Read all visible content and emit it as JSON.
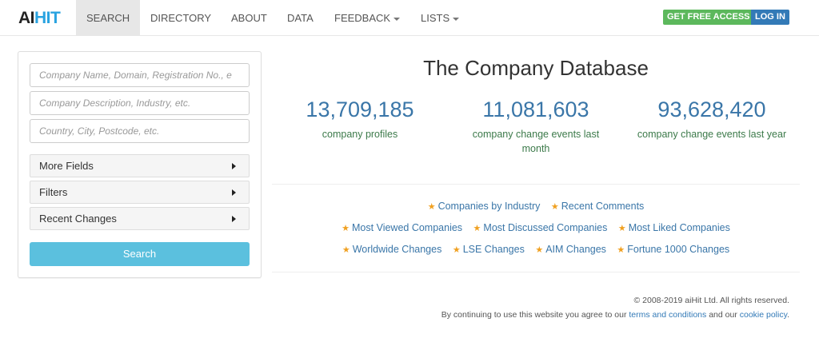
{
  "brand": {
    "ai": "AI",
    "hit": "HIT"
  },
  "nav": {
    "items": [
      {
        "label": "SEARCH",
        "active": true
      },
      {
        "label": "DIRECTORY"
      },
      {
        "label": "ABOUT"
      },
      {
        "label": "DATA"
      },
      {
        "label": "FEEDBACK",
        "dropdown": true
      },
      {
        "label": "LISTS",
        "dropdown": true
      }
    ],
    "get_free_access": "GET FREE ACCESS",
    "log_in": "LOG IN"
  },
  "search": {
    "company_placeholder": "Company Name, Domain, Registration No., e",
    "description_placeholder": "Company Description, Industry, etc.",
    "location_placeholder": "Country, City, Postcode, etc.",
    "more_fields": "More Fields",
    "filters": "Filters",
    "recent_changes": "Recent Changes",
    "button": "Search"
  },
  "main": {
    "title": "The Company Database",
    "stats": [
      {
        "value": "13,709,185",
        "label": "company profiles"
      },
      {
        "value": "11,081,603",
        "label": "company change events last month"
      },
      {
        "value": "93,628,420",
        "label": "company change events last year"
      }
    ],
    "links": {
      "row1": [
        "Companies by Industry",
        "Recent Comments"
      ],
      "row2": [
        "Most Viewed Companies",
        "Most Discussed Companies",
        "Most Liked Companies"
      ],
      "row3": [
        "Worldwide Changes",
        "LSE Changes",
        "AIM Changes",
        "Fortune 1000 Changes"
      ]
    }
  },
  "footer": {
    "copyright": "© 2008-2019 aiHit Ltd. All rights reserved.",
    "consent_prefix": "By continuing to use this website you agree to our ",
    "terms": "terms and conditions",
    "consent_middle": " and our ",
    "cookie": "cookie policy",
    "consent_suffix": "."
  },
  "colors": {
    "accent": "#29a3e0",
    "link": "#3a76a8",
    "success": "#5cb85c",
    "primary": "#337ab7",
    "info": "#5bc0de",
    "star": "#f0a020"
  }
}
